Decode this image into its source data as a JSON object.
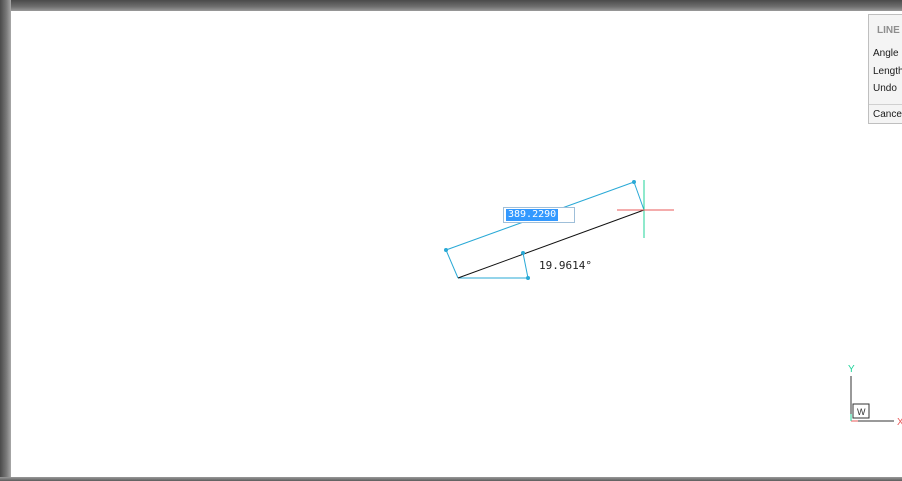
{
  "context_menu": {
    "title": "LINE",
    "items": [
      "Angle",
      "Length",
      "Undo"
    ],
    "cancel_label": "Cancel"
  },
  "dynamic_input": {
    "length_value": "389.2290"
  },
  "angle_readout": "19.9614°",
  "ucs_icon": {
    "y_label": "Y",
    "x_label": "X",
    "w_label": "W"
  },
  "colors": {
    "dimension": "#29a9d6",
    "crosshair_vertical": "#1fd39a",
    "crosshair_horizontal": "#e85a5a",
    "line": "#111111",
    "selection": "#3399ff"
  }
}
